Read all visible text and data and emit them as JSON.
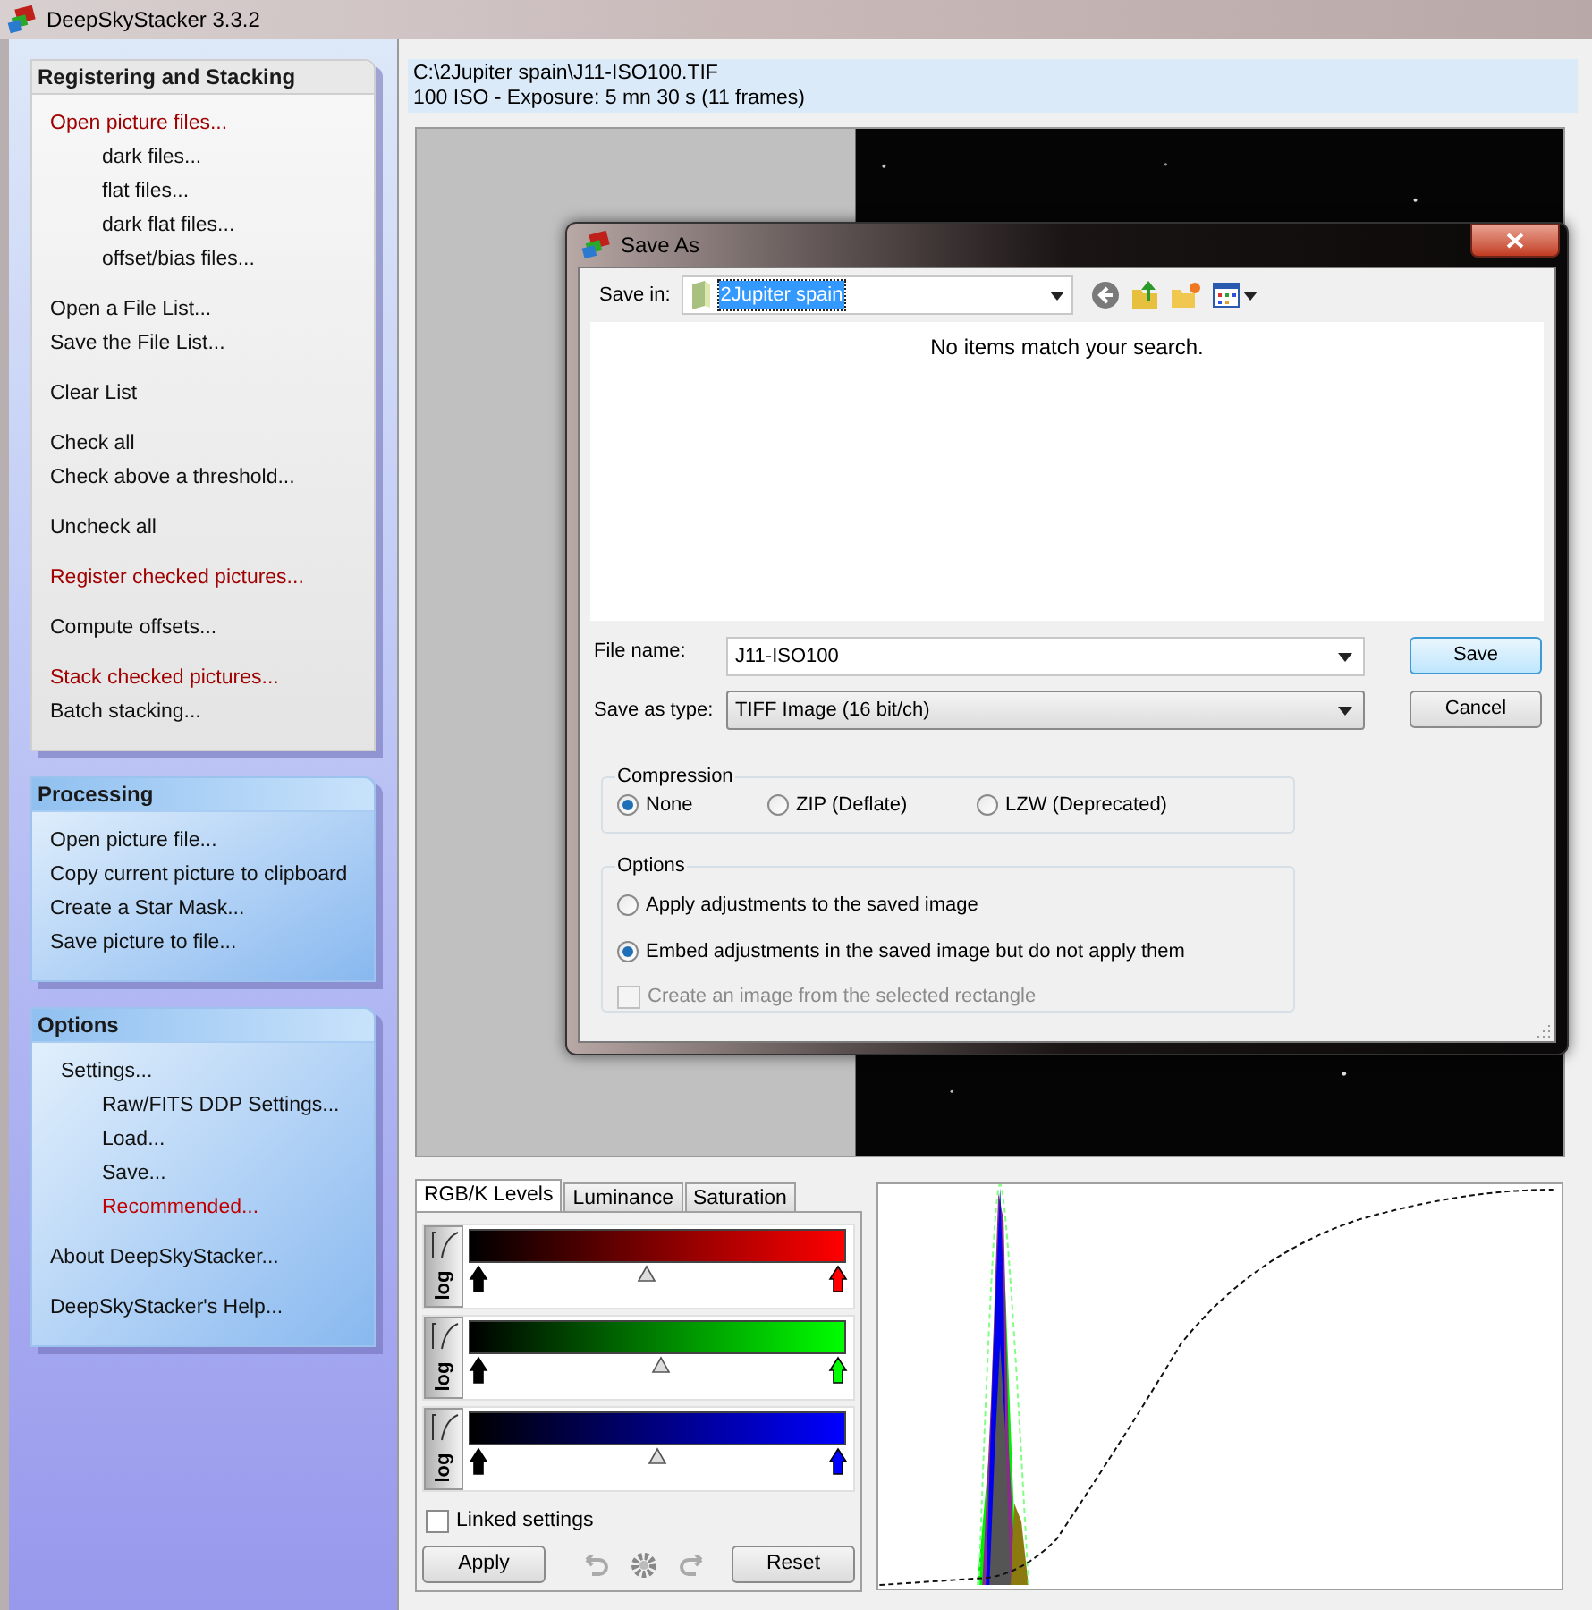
{
  "window": {
    "title": "DeepSkyStacker 3.3.2"
  },
  "sidebar": {
    "sections": [
      {
        "title": "Registering and Stacking",
        "groups": [
          [
            {
              "label": "Open picture files...",
              "color": "#a00000",
              "children": [
                {
                  "label": "dark files..."
                },
                {
                  "label": "flat files..."
                },
                {
                  "label": "dark flat files..."
                },
                {
                  "label": "offset/bias files..."
                }
              ]
            }
          ],
          [
            {
              "label": "Open a File List..."
            },
            {
              "label": "Save the File List..."
            }
          ],
          [
            {
              "label": "Clear List"
            }
          ],
          [
            {
              "label": "Check all"
            },
            {
              "label": "Check above a threshold..."
            }
          ],
          [
            {
              "label": "Uncheck all"
            }
          ],
          [
            {
              "label": "Register checked pictures...",
              "color": "#a00000"
            }
          ],
          [
            {
              "label": "Compute offsets..."
            }
          ],
          [
            {
              "label": "Stack checked pictures...",
              "color": "#a00000"
            },
            {
              "label": "Batch stacking..."
            }
          ]
        ]
      },
      {
        "title": "Processing",
        "groups": [
          [
            {
              "label": "Open picture file..."
            },
            {
              "label": "Copy current picture to clipboard"
            },
            {
              "label": "Create a Star Mask..."
            },
            {
              "label": "Save picture to file..."
            }
          ]
        ]
      },
      {
        "title": "Options",
        "groups": [
          [
            {
              "label": "Settings...",
              "children": [
                {
                  "label": "Raw/FITS DDP Settings..."
                },
                {
                  "label": "Load..."
                },
                {
                  "label": "Save..."
                },
                {
                  "label": "Recommended...",
                  "color": "#c00000"
                }
              ]
            }
          ],
          [
            {
              "label": "About DeepSkyStacker..."
            }
          ],
          [
            {
              "label": "DeepSkyStacker's Help..."
            }
          ]
        ]
      }
    ]
  },
  "file_info": {
    "path": "C:\\2Jupiter spain\\J11-ISO100.TIF",
    "details": "100 ISO - Exposure: 5 mn 30 s (11 frames)"
  },
  "dialog": {
    "title": "Save As",
    "save_in_label": "Save in:",
    "save_in": "2Jupiter spain",
    "empty_message": "No items match your search.",
    "file_name_label": "File name:",
    "file_name": "J11-ISO100",
    "type_label": "Save as type:",
    "type": "TIFF Image (16 bit/ch)",
    "buttons": [
      {
        "label": "Save",
        "selected": true
      },
      {
        "label": "Cancel",
        "selected": false
      }
    ],
    "compression": {
      "title": "Compression",
      "options": [
        {
          "label": "None",
          "selected": true
        },
        {
          "label": "ZIP (Deflate)",
          "selected": false
        },
        {
          "label": "LZW (Deprecated)",
          "selected": false
        }
      ]
    },
    "options": {
      "title": "Options",
      "choices": [
        {
          "label": "Apply adjustments to the saved image",
          "selected": false
        },
        {
          "label": "Embed adjustments in the saved image but do not apply them",
          "selected": true
        }
      ],
      "checkbox": {
        "label": "Create an image from the selected rectangle",
        "checked": false,
        "disabled": true
      }
    }
  },
  "levels": {
    "tabs": [
      {
        "label": "RGB/K Levels",
        "selected": true
      },
      {
        "label": "Luminance",
        "selected": false
      },
      {
        "label": "Saturation",
        "selected": false
      }
    ],
    "channels": [
      {
        "color": "#ff0000",
        "log_label": "log",
        "markers": [
          {
            "kind": "black",
            "level": 0
          },
          {
            "kind": "mid",
            "level": 0.47
          },
          {
            "kind": "white",
            "level": 1
          }
        ]
      },
      {
        "color": "#00ff00",
        "log_label": "log",
        "markers": [
          {
            "kind": "black",
            "level": 0
          },
          {
            "kind": "mid",
            "level": 0.51
          },
          {
            "kind": "white",
            "level": 1
          }
        ]
      },
      {
        "color": "#0000ff",
        "log_label": "log",
        "markers": [
          {
            "kind": "black",
            "level": 0
          },
          {
            "kind": "mid",
            "level": 0.5
          },
          {
            "kind": "white",
            "level": 1
          }
        ]
      }
    ],
    "linked": {
      "label": "Linked settings",
      "checked": false
    },
    "apply": "Apply",
    "reset": "Reset"
  }
}
